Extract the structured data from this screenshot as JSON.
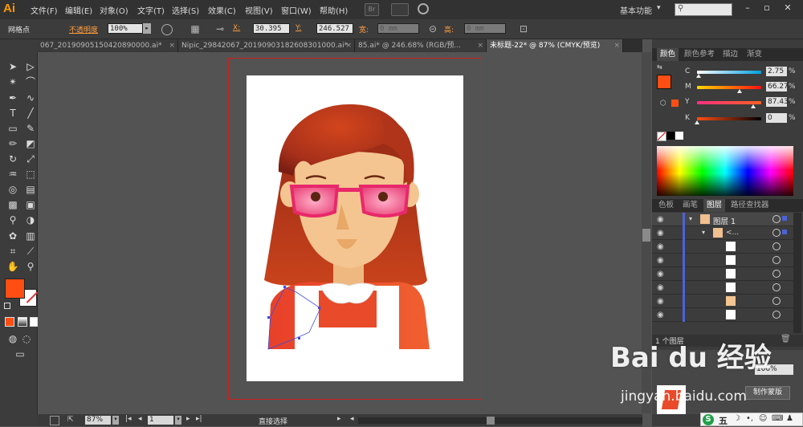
{
  "app": {
    "logo": "Ai"
  },
  "menu": {
    "items": [
      "文件(F)",
      "编辑(E)",
      "对象(O)",
      "文字(T)",
      "选择(S)",
      "效果(C)",
      "视图(V)",
      "窗口(W)",
      "帮助(H)"
    ],
    "br_label": "Br",
    "workspace": "基本功能",
    "workspace_arrow": "▾"
  },
  "control": {
    "selection_label": "网格点",
    "opacity_label": "不透明度",
    "opacity_value": "100%",
    "x_label": "X:",
    "x_value": "30.395",
    "y_label": "Y:",
    "y_value": "246.527",
    "w_label": "宽:",
    "w_value": "0 mm",
    "h_label": "高:",
    "h_value": "0 mm"
  },
  "tabs": [
    {
      "label": "067_20190905150420890000.ai*",
      "close": "×"
    },
    {
      "label": "Nipic_29842067_20190903182608301000.ai*",
      "close": "×"
    },
    {
      "label": "85.ai* @ 246.68% (RGB/预...",
      "close": "×"
    },
    {
      "label": "未标题-22* @ 87% (CMYK/预览)",
      "close": "×"
    }
  ],
  "colors": {
    "fill": "#ff4e14",
    "hair": "#b8371a",
    "skin": "#f4c590",
    "glasses": "#e8286a",
    "shirt": "#e84a2a",
    "red_border": "#d02020",
    "vertex": "#3c4ce0"
  },
  "color_panel": {
    "tabs": [
      "颜色",
      "颜色参考",
      "描边",
      "渐变"
    ],
    "channels": [
      {
        "name": "C",
        "value": "2.75",
        "pct": "%",
        "pos": 0.03,
        "colors": [
          "#ffffff",
          "#00a0e0"
        ]
      },
      {
        "name": "M",
        "value": "66.27",
        "pct": "%",
        "pos": 0.66,
        "colors": [
          "#ffd800",
          "#ff1010"
        ]
      },
      {
        "name": "Y",
        "value": "87.43",
        "pct": "%",
        "pos": 0.87,
        "colors": [
          "#ff3080",
          "#ff6020"
        ]
      },
      {
        "name": "K",
        "value": "0",
        "pct": "%",
        "pos": 0.0,
        "colors": [
          "#ff4e14",
          "#000000"
        ]
      }
    ]
  },
  "layers_panel": {
    "tabs": [
      "色板",
      "画笔",
      "图层",
      "路径查找器"
    ],
    "layer_name": "图层 1",
    "group_name": "<...",
    "count": "1 个图层"
  },
  "status": {
    "zoom": "87%",
    "page": "1",
    "tool_label": "直接选择"
  },
  "bottom_panel": {
    "opacity_value": "100%",
    "make_mask": "制作蒙版"
  },
  "watermark": {
    "text": "Bai du 经验",
    "url": "jingyan.baidu.com"
  },
  "ime": {
    "label": "五"
  }
}
